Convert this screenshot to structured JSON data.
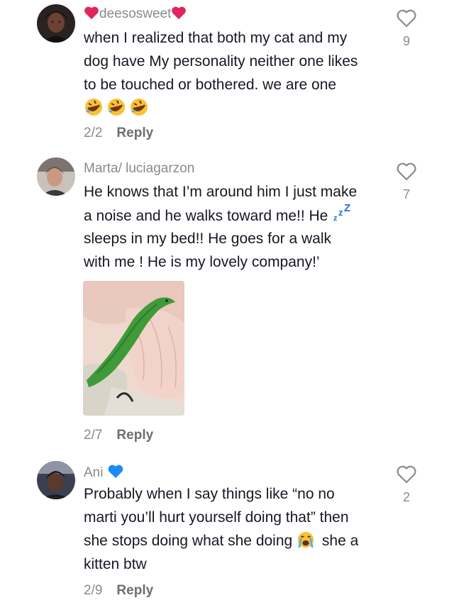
{
  "comments": [
    {
      "username": "deesosweet",
      "lines": [
        "when I realized that both my cat and my",
        "dog have My personality neither one likes",
        "to be touched or bothered. we are one"
      ],
      "meta_index": "2/2",
      "reply_label": "Reply",
      "likes": "9",
      "emojis": [
        "rofl-emoji",
        "rofl-emoji",
        "rofl-emoji"
      ]
    },
    {
      "username": "Marta/ luciagarzon",
      "lines": [
        "He knows that I’m around him I just make",
        "a noise and he walks toward me!! He",
        "sleeps in my bed!! He goes for a walk",
        "with me ! He is my lovely company!’"
      ],
      "meta_index": "2/7",
      "reply_label": "Reply",
      "likes": "7"
    },
    {
      "username": "Ani",
      "lines": [
        "Probably when I say things like “no no",
        "marti you’ll hurt yourself doing that” then",
        "she stops doing what she doing",
        "kitten btw"
      ],
      "line3_tail": "she a",
      "meta_index": "2/9",
      "reply_label": "Reply",
      "likes": "2"
    }
  ],
  "icons": {
    "like": "heart-outline-icon",
    "heart_red": "red-heart-emoji",
    "heart_blue": "blue-heart-emoji",
    "sleep": "zzz-emoji",
    "crying": "crying-face-emoji"
  },
  "colors": {
    "text": "#161823",
    "muted": "#8a8a8a",
    "heart_red": "#e0245e",
    "heart_blue": "#1d8af5"
  }
}
